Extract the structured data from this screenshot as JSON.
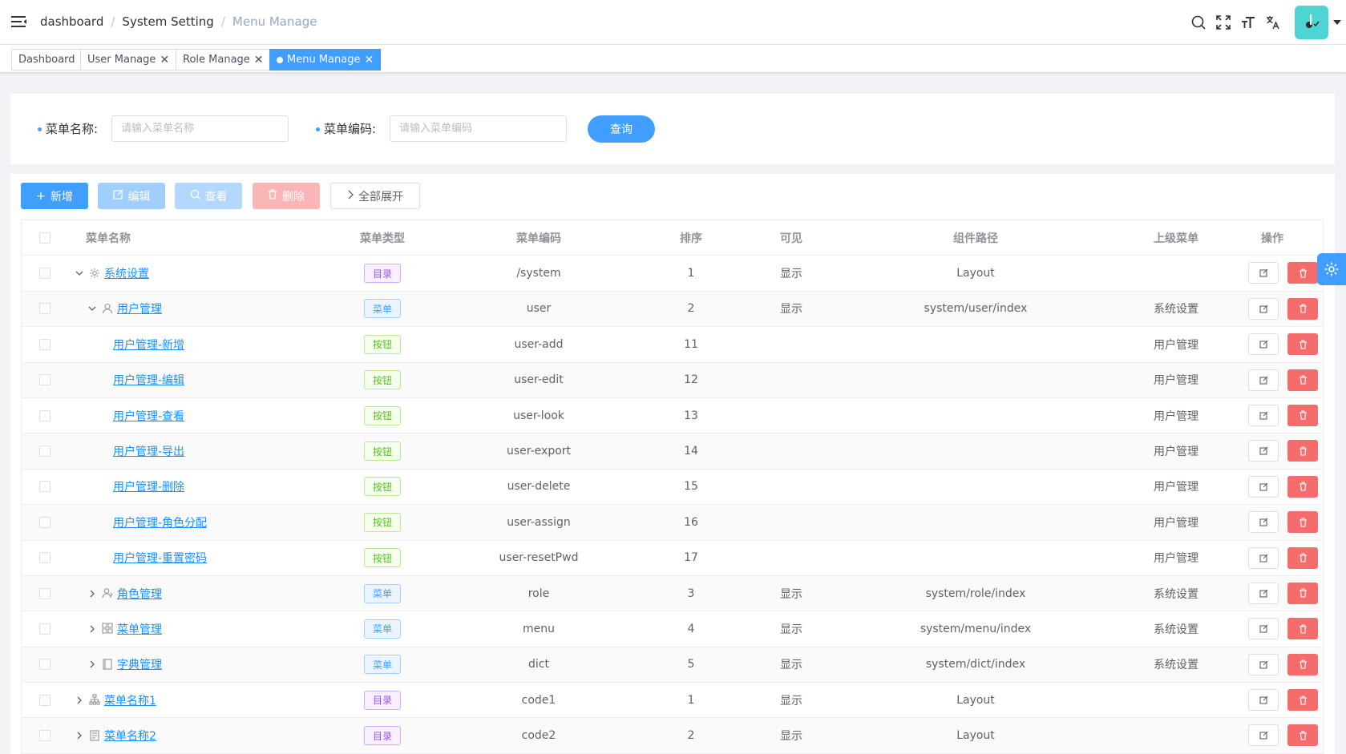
{
  "header": {
    "breadcrumbs": [
      "dashboard",
      "System Setting",
      "Menu Manage"
    ],
    "separator": "/"
  },
  "icons": {
    "hamburger": "hamburger-icon",
    "search": "search-icon",
    "fullscreen": "fullscreen-icon",
    "size": "font-size-icon",
    "language": "translate-icon",
    "caret": "caret-down-icon"
  },
  "tags": [
    {
      "label": "Dashboard",
      "closable": false,
      "active": false
    },
    {
      "label": "User Manage",
      "closable": true,
      "active": false
    },
    {
      "label": "Role Manage",
      "closable": true,
      "active": false
    },
    {
      "label": "Menu Manage",
      "closable": true,
      "active": true
    }
  ],
  "search": {
    "name_label": "菜单名称:",
    "name_placeholder": "请输入菜单名称",
    "code_label": "菜单编码:",
    "code_placeholder": "请输入菜单编码",
    "query_label": "查询"
  },
  "toolbar": {
    "add_label": "新增",
    "edit_label": "编辑",
    "view_label": "查看",
    "delete_label": "删除",
    "expand_label": "全部展开"
  },
  "table": {
    "columns": [
      "菜单名称",
      "菜单类型",
      "菜单编码",
      "排序",
      "可见",
      "组件路径",
      "上级菜单",
      "操作"
    ],
    "rows": [
      {
        "name": "系统设置",
        "type": "目录",
        "code": "/system",
        "order": "1",
        "visible": "显示",
        "path": "Layout",
        "parent": "",
        "icon": "gear-icon",
        "expand": "down"
      },
      {
        "name": "用户管理",
        "type": "菜单",
        "code": "user",
        "order": "2",
        "visible": "显示",
        "path": "system/user/index",
        "parent": "系统设置",
        "icon": "user-icon",
        "expand": "down"
      },
      {
        "name": "用户管理-新增",
        "type": "按钮",
        "code": "user-add",
        "order": "11",
        "visible": "",
        "path": "",
        "parent": "用户管理",
        "icon": "",
        "expand": ""
      },
      {
        "name": "用户管理-编辑",
        "type": "按钮",
        "code": "user-edit",
        "order": "12",
        "visible": "",
        "path": "",
        "parent": "用户管理",
        "icon": "",
        "expand": ""
      },
      {
        "name": "用户管理-查看",
        "type": "按钮",
        "code": "user-look",
        "order": "13",
        "visible": "",
        "path": "",
        "parent": "用户管理",
        "icon": "",
        "expand": ""
      },
      {
        "name": "用户管理-导出",
        "type": "按钮",
        "code": "user-export",
        "order": "14",
        "visible": "",
        "path": "",
        "parent": "用户管理",
        "icon": "",
        "expand": ""
      },
      {
        "name": "用户管理-删除",
        "type": "按钮",
        "code": "user-delete",
        "order": "15",
        "visible": "",
        "path": "",
        "parent": "用户管理",
        "icon": "",
        "expand": ""
      },
      {
        "name": "用户管理-角色分配",
        "type": "按钮",
        "code": "user-assign",
        "order": "16",
        "visible": "",
        "path": "",
        "parent": "用户管理",
        "icon": "",
        "expand": ""
      },
      {
        "name": "用户管理-重置密码",
        "type": "按钮",
        "code": "user-resetPwd",
        "order": "17",
        "visible": "",
        "path": "",
        "parent": "用户管理",
        "icon": "",
        "expand": ""
      },
      {
        "name": "角色管理",
        "type": "菜单",
        "code": "role",
        "order": "3",
        "visible": "显示",
        "path": "system/role/index",
        "parent": "系统设置",
        "icon": "role-icon",
        "expand": "right"
      },
      {
        "name": "菜单管理",
        "type": "菜单",
        "code": "menu",
        "order": "4",
        "visible": "显示",
        "path": "system/menu/index",
        "parent": "系统设置",
        "icon": "grid-icon",
        "expand": "right"
      },
      {
        "name": "字典管理",
        "type": "菜单",
        "code": "dict",
        "order": "5",
        "visible": "显示",
        "path": "system/dict/index",
        "parent": "系统设置",
        "icon": "book-icon",
        "expand": "right"
      },
      {
        "name": "菜单名称1",
        "type": "目录",
        "code": "code1",
        "order": "1",
        "visible": "显示",
        "path": "Layout",
        "parent": "",
        "icon": "tree-icon",
        "expand": "right"
      },
      {
        "name": "菜单名称2",
        "type": "目录",
        "code": "code2",
        "order": "2",
        "visible": "显示",
        "path": "Layout",
        "parent": "",
        "icon": "doc-icon",
        "expand": "right"
      }
    ]
  },
  "colors": {
    "primary": "#409eff",
    "danger": "#f56c6c",
    "link": "#1890ff",
    "avatar": "#4fd4d4"
  }
}
